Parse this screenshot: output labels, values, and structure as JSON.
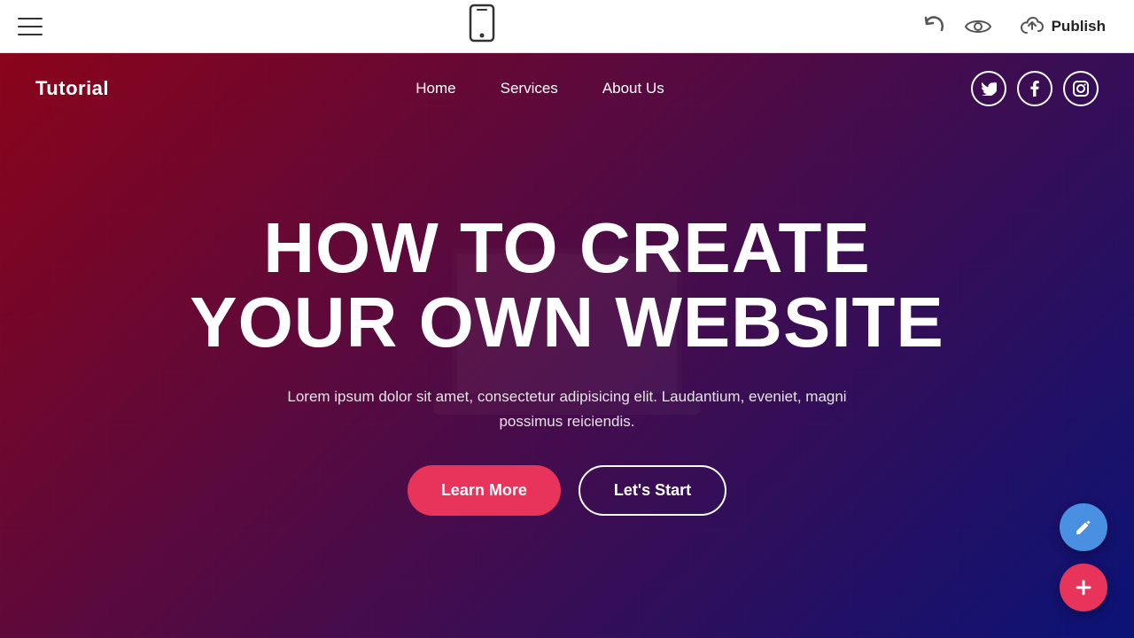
{
  "toolbar": {
    "hamburger_label": "menu",
    "phone_icon_label": "mobile-preview",
    "undo_icon_label": "undo",
    "eye_icon_label": "preview",
    "publish_label": "Publish",
    "publish_icon_label": "cloud-upload-icon"
  },
  "site": {
    "logo": "Tutorial",
    "nav": {
      "links": [
        {
          "id": "home",
          "label": "Home"
        },
        {
          "id": "services",
          "label": "Services"
        },
        {
          "id": "about",
          "label": "About Us"
        }
      ]
    },
    "social": {
      "icons": [
        {
          "id": "twitter",
          "symbol": "𝕋",
          "label": "twitter-icon"
        },
        {
          "id": "facebook",
          "symbol": "f",
          "label": "facebook-icon"
        },
        {
          "id": "instagram",
          "symbol": "📷",
          "label": "instagram-icon"
        }
      ]
    },
    "hero": {
      "title_line1": "HOW TO CREATE",
      "title_line2": "YOUR OWN WEBSITE",
      "subtitle": "Lorem ipsum dolor sit amet, consectetur adipisicing elit. Laudantium, eveniet, magni possimus reiciendis.",
      "btn_learn_more": "Learn More",
      "btn_lets_start": "Let's Start"
    }
  },
  "fab": {
    "edit_icon": "✏",
    "add_icon": "+"
  },
  "colors": {
    "accent_red": "#e8345a",
    "accent_blue": "#4a90e2",
    "hero_gradient_left": "rgba(160,0,30,0.75)",
    "hero_gradient_right": "rgba(10,20,120,0.75)"
  }
}
